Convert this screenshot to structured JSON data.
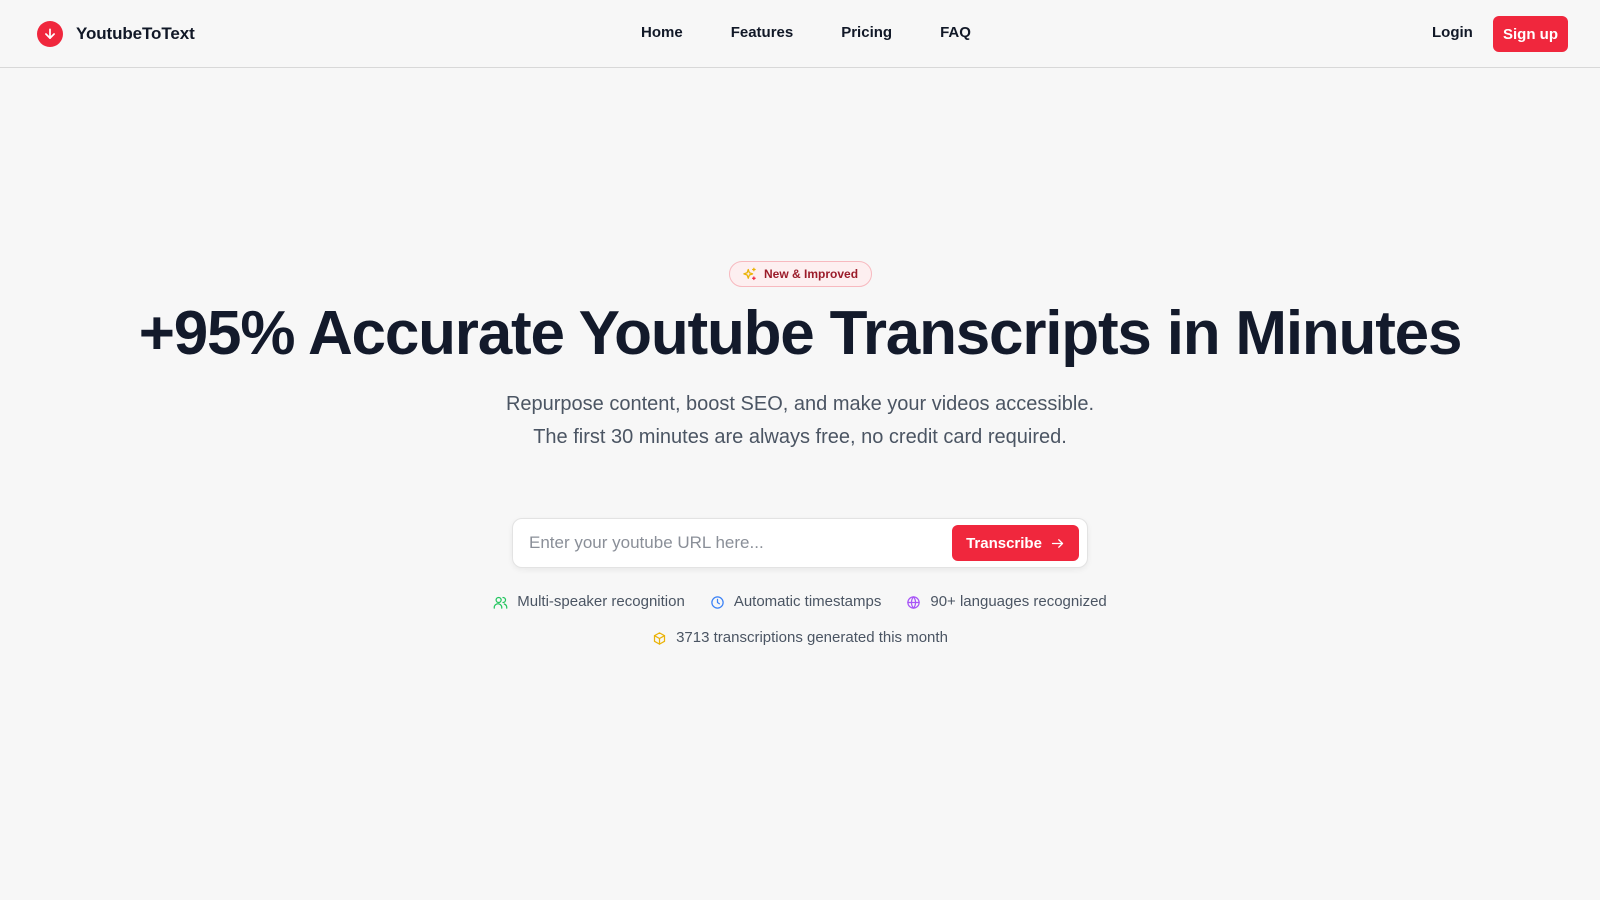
{
  "brand": {
    "name": "YoutubeToText",
    "logo_icon": "arrow-down-circle-icon",
    "color": "#f0273d"
  },
  "nav": {
    "items": [
      {
        "label": "Home"
      },
      {
        "label": "Features"
      },
      {
        "label": "Pricing"
      },
      {
        "label": "FAQ"
      }
    ],
    "login_label": "Login",
    "signup_label": "Sign up"
  },
  "hero": {
    "badge": {
      "icon": "sparkles-icon",
      "label": "New & Improved"
    },
    "headline": "+95% Accurate Youtube Transcripts in Minutes",
    "subtitle_line1": "Repurpose content, boost SEO, and make your videos accessible.",
    "subtitle_line2": "The first 30 minutes are always free, no credit card required.",
    "url_input": {
      "value": "",
      "placeholder": "Enter your youtube URL here..."
    },
    "transcribe_label": "Transcribe",
    "features": [
      {
        "icon": "users-icon",
        "label": "Multi-speaker recognition",
        "color": "#22c55e"
      },
      {
        "icon": "clock-icon",
        "label": "Automatic timestamps",
        "color": "#3b82f6"
      },
      {
        "icon": "globe-icon",
        "label": "90+ languages recognized",
        "color": "#a855f7"
      }
    ],
    "stat": {
      "icon": "package-icon",
      "label": "3713 transcriptions generated this month",
      "color": "#eab308"
    }
  },
  "colors": {
    "accent": "#f0273d",
    "text": "#131a2b",
    "muted": "#4b5563",
    "background": "#f7f7f7"
  }
}
